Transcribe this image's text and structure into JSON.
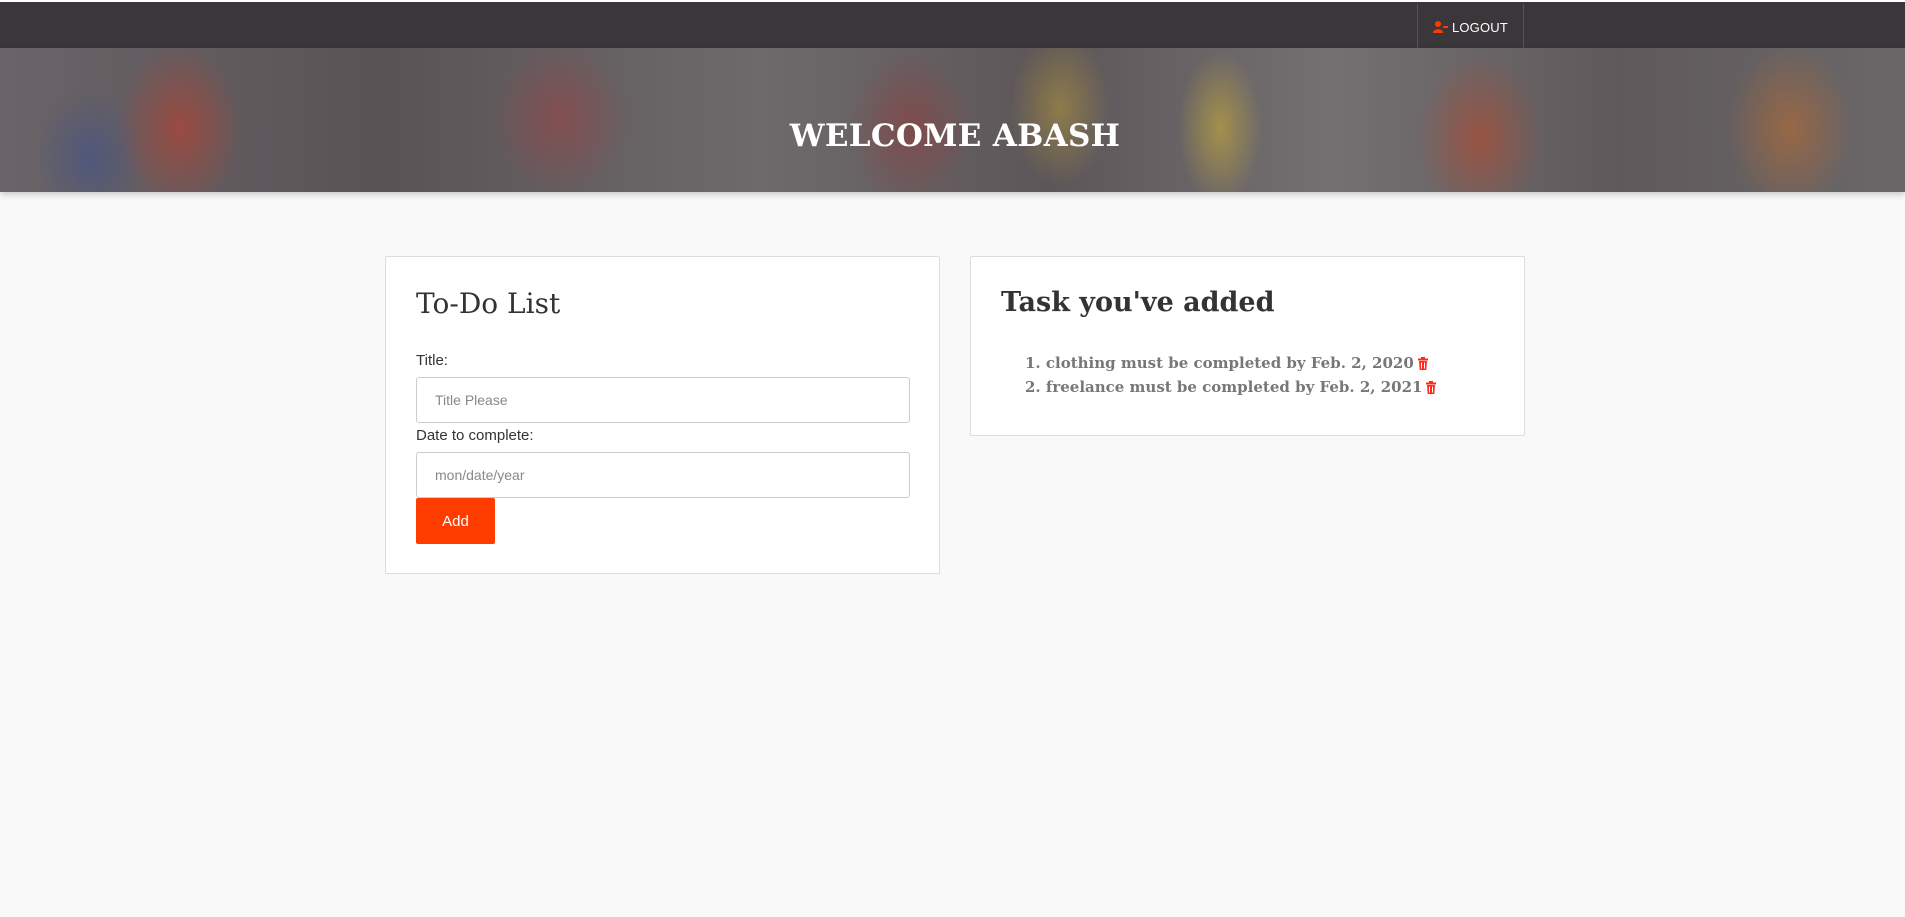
{
  "header": {
    "logout_label": "LOGOUT",
    "logout_icon": "user-minus-icon"
  },
  "hero": {
    "title": "WELCOME ABASH"
  },
  "todo_form": {
    "title": "To-Do List",
    "title_label": "Title:",
    "title_placeholder": "Title Please",
    "date_label": "Date to complete:",
    "date_placeholder": "mon/date/year",
    "add_label": "Add"
  },
  "task_list": {
    "title": "Task you've added",
    "delete_icon": "trash-icon",
    "items": [
      {
        "text": "1. clothing must be completed by Feb. 2, 2020"
      },
      {
        "text": "2. freelance must be completed by Feb. 2, 2021"
      }
    ]
  },
  "colors": {
    "accent": "#ff3c00",
    "navbar": "#3b3639",
    "background": "#f9f9f9"
  }
}
